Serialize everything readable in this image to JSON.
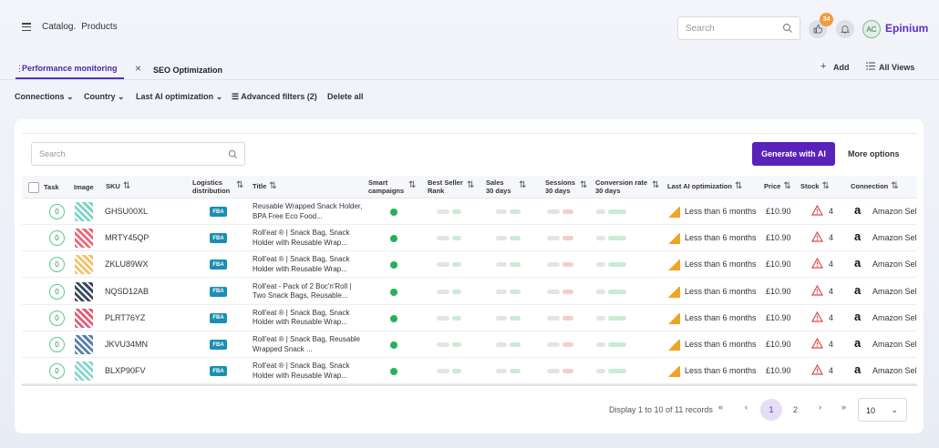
{
  "breadcrumb": [
    "Catalog.",
    "Products"
  ],
  "header": {
    "search_placeholder": "Search",
    "notif_count": "34",
    "avatar_initials": "AC",
    "org_name": "Epinium"
  },
  "tabs": {
    "active": "Performance monitoring",
    "second": "SEO Optimization",
    "add": "Add",
    "all_views": "All Views"
  },
  "filters": [
    "Connections",
    "Country",
    "Last AI optimization"
  ],
  "advanced_filters": "Advanced filters (2)",
  "delete_all": "Delete all",
  "table_search_placeholder": "Search",
  "generate_label": "Generate with AI",
  "more_options": "More options",
  "columns": {
    "task": "Task",
    "image": "Image",
    "sku": "SKU",
    "logistics": [
      "Logistics",
      "distribution"
    ],
    "title": "Title",
    "smart": [
      "Smart",
      "campaigns"
    ],
    "bsr": [
      "Best Seller",
      "Rank"
    ],
    "sales": [
      "Sales",
      "30 days"
    ],
    "sessions": [
      "Sessions",
      "30 days"
    ],
    "conv": [
      "Conversion rate",
      "30 days"
    ],
    "lastai": "Last AI optimization",
    "price": "Price",
    "stock": "Stock",
    "connection": "Connection"
  },
  "rows": [
    {
      "task": "0",
      "sku": "GHSU00XL",
      "fba": "FBA",
      "title": "Reusable Wrapped Snack Holder, BPA Free Eco Food...",
      "last_ai": "Less than 6 months",
      "price": "£10.90",
      "stock": "4",
      "connection": "Amazon Sel",
      "thumb_color": "#7fd4c9"
    },
    {
      "task": "0",
      "sku": "MRTY45QP",
      "fba": "FBA",
      "title": "Roll'eat ® | Snack Bag, Snack Holder with Reusable Wrap...",
      "last_ai": "Less than 6 months",
      "price": "£10.90",
      "stock": "4",
      "connection": "Amazon Sel",
      "thumb_color": "#e86a7c"
    },
    {
      "task": "0",
      "sku": "ZKLU89WX",
      "fba": "FBA",
      "title": "Roll'eat ® | Snack Bag, Snack Holder with Reusable Wrap...",
      "last_ai": "Less than 6 months",
      "price": "£10.90",
      "stock": "4",
      "connection": "Amazon Sel",
      "thumb_color": "#f2c26b"
    },
    {
      "task": "0",
      "sku": "NQSD12AB",
      "fba": "FBA",
      "title": "Roll'eat - Pack of 2 Boc'n'Roll | Two Snack Bags, Reusable...",
      "last_ai": "Less than 6 months",
      "price": "£10.90",
      "stock": "4",
      "connection": "Amazon Sel",
      "thumb_color": "#3b4a5e"
    },
    {
      "task": "0",
      "sku": "PLRT76YZ",
      "fba": "FBA",
      "title": "Roll'eat ® | Snack Bag, Snack Holder with Reusable Wrap...",
      "last_ai": "Less than 6 months",
      "price": "£10.90",
      "stock": "4",
      "connection": "Amazon Sel",
      "thumb_color": "#e0607a"
    },
    {
      "task": "0",
      "sku": "JKVU34MN",
      "fba": "FBA",
      "title": "Roll'eat ® | Snack Bag, Reusable Wrapped Snack ...",
      "last_ai": "Less than 6 months",
      "price": "£10.90",
      "stock": "4",
      "connection": "Amazon Sel",
      "thumb_color": "#5a7fae"
    },
    {
      "task": "0",
      "sku": "BLXP90FV",
      "fba": "FBA",
      "title": "Roll'eat ® | Snack Bag, Snack Holder with Reusable Wrap...",
      "last_ai": "Less than 6 months",
      "price": "£10.90",
      "stock": "4",
      "connection": "Amazon Sel",
      "thumb_color": "#8ad6cf"
    }
  ],
  "pagination": {
    "info": "Display 1 to 10 of 11 records",
    "first": "«",
    "prev": "‹",
    "current": "1",
    "next_page": "2",
    "next": "›",
    "last": "»",
    "page_size": "10"
  },
  "colors": {
    "accent": "#5a22b8",
    "fba": "#1a8fb1",
    "ok": "#23b25b",
    "warn": "#f1a322",
    "alert": "#e04848"
  }
}
